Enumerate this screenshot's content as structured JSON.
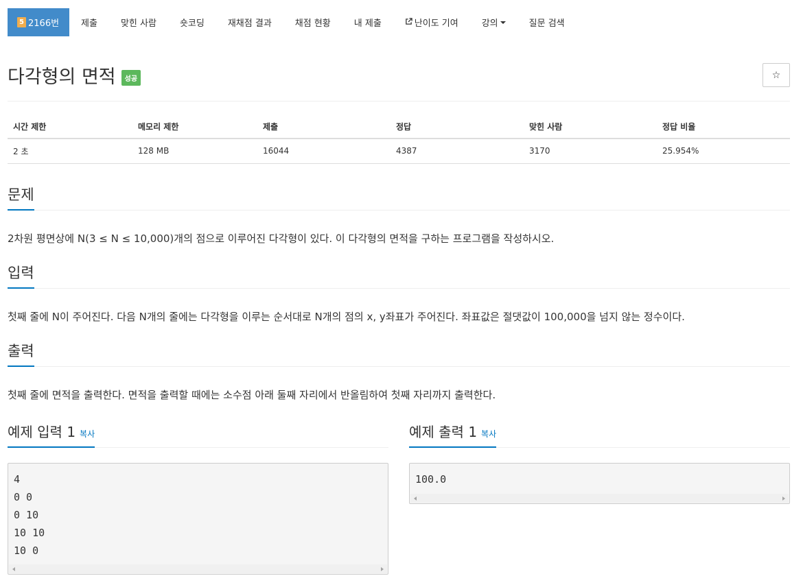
{
  "nav": {
    "problem_badge": "5",
    "problem_number": "2166번",
    "items": [
      {
        "label": "제출"
      },
      {
        "label": "맞힌 사람"
      },
      {
        "label": "숏코딩"
      },
      {
        "label": "재채점 결과"
      },
      {
        "label": "채점 현황"
      },
      {
        "label": "내 제출"
      },
      {
        "label": "난이도 기여",
        "icon": "external-link-icon"
      },
      {
        "label": "강의",
        "dropdown": true
      },
      {
        "label": "질문 검색"
      }
    ]
  },
  "problem": {
    "title": "다각형의 면적",
    "status_label": "성공",
    "star_icon": "☆"
  },
  "stats": {
    "headers": [
      "시간 제한",
      "메모리 제한",
      "제출",
      "정답",
      "맞힌 사람",
      "정답 비율"
    ],
    "values": [
      "2 초",
      "128 MB",
      "16044",
      "4387",
      "3170",
      "25.954%"
    ]
  },
  "sections": {
    "description": {
      "heading": "문제",
      "text": "2차원 평면상에 N(3 ≤ N ≤ 10,000)개의 점으로 이루어진 다각형이 있다. 이 다각형의 면적을 구하는 프로그램을 작성하시오."
    },
    "input": {
      "heading": "입력",
      "text": "첫째 줄에 N이 주어진다. 다음 N개의 줄에는 다각형을 이루는 순서대로 N개의 점의 x, y좌표가 주어진다. 좌표값은 절댓값이 100,000을 넘지 않는 정수이다."
    },
    "output": {
      "heading": "출력",
      "text": "첫째 줄에 면적을 출력한다. 면적을 출력할 때에는 소수점 아래 둘째 자리에서 반올림하여 첫째 자리까지 출력한다."
    }
  },
  "examples": {
    "input": {
      "heading": "예제 입력 1",
      "copy_label": "복사",
      "lines": [
        "4",
        "0 0",
        "0 10",
        "10 10",
        "10 0"
      ]
    },
    "output": {
      "heading": "예제 출력 1",
      "copy_label": "복사",
      "lines": [
        "100.0"
      ]
    }
  },
  "colors": {
    "accent": "#428bca",
    "badge": "#f0ad4e",
    "success": "#5cb85c",
    "link": "#0076c0"
  }
}
